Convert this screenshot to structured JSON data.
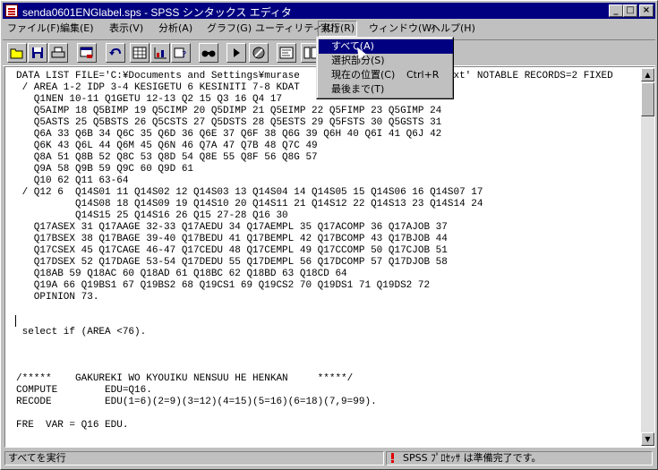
{
  "window": {
    "title": "senda0601ENGlabel.sps - SPSS シンタックス エディタ"
  },
  "menubar": {
    "items": [
      "ファイル(F)",
      "編集(E)",
      "表示(V)",
      "分析(A)",
      "グラフ(G)",
      "ユーティリティ(U)",
      "実行(R)",
      "ウィンドウ(W)",
      "ヘルプ(H)"
    ],
    "active_index": 6
  },
  "toolbar": {
    "buttons": [
      "open-icon",
      "save-icon",
      "print-icon",
      "dialog-recall-icon",
      "undo-icon",
      "goto-data-icon",
      "goto-chart-icon",
      "variables-icon",
      "find-icon",
      "run-icon",
      "stop-icon",
      "syntax-help-icon",
      "use-sets-icon"
    ]
  },
  "run_menu": {
    "items": [
      {
        "label": "すべて(A)",
        "shortcut": "",
        "selected": true
      },
      {
        "label": "選択部分(S)",
        "shortcut": "",
        "selected": false
      },
      {
        "label": "現在の位置(C)",
        "shortcut": "Ctrl+R",
        "selected": false
      },
      {
        "label": "最後まで(T)",
        "shortcut": "",
        "selected": false
      }
    ]
  },
  "editor": {
    "lines": [
      "DATA LIST FILE='C:¥Documents and Settings¥murase                        .txt' NOTABLE RECORDS=2 FIXED",
      " / AREA 1-2 IDP 3-4 KESIGETU 6 KESINITI 7-8 KDAT",
      "   Q1NEN 10-11 Q1GETU 12-13 Q2 15 Q3 16 Q4 17",
      "   Q5AIMP 18 Q5BIMP 19 Q5CIMP 20 Q5DIMP 21 Q5EIMP 22 Q5FIMP 23 Q5GIMP 24",
      "   Q5ASTS 25 Q5BSTS 26 Q5CSTS 27 Q5DSTS 28 Q5ESTS 29 Q5FSTS 30 Q5GSTS 31",
      "   Q6A 33 Q6B 34 Q6C 35 Q6D 36 Q6E 37 Q6F 38 Q6G 39 Q6H 40 Q6I 41 Q6J 42",
      "   Q6K 43 Q6L 44 Q6M 45 Q6N 46 Q7A 47 Q7B 48 Q7C 49",
      "   Q8A 51 Q8B 52 Q8C 53 Q8D 54 Q8E 55 Q8F 56 Q8G 57",
      "   Q9A 58 Q9B 59 Q9C 60 Q9D 61",
      "   Q10 62 Q11 63-64",
      " / Q12 6  Q14S01 11 Q14S02 12 Q14S03 13 Q14S04 14 Q14S05 15 Q14S06 16 Q14S07 17",
      "          Q14S08 18 Q14S09 19 Q14S10 20 Q14S11 21 Q14S12 22 Q14S13 23 Q14S14 24",
      "          Q14S15 25 Q14S16 26 Q15 27-28 Q16 30",
      "   Q17ASEX 31 Q17AAGE 32-33 Q17AEDU 34 Q17AEMPL 35 Q17ACOMP 36 Q17AJOB 37",
      "   Q17BSEX 38 Q17BAGE 39-40 Q17BEDU 41 Q17BEMPL 42 Q17BCOMP 43 Q17BJOB 44",
      "   Q17CSEX 45 Q17CAGE 46-47 Q17CEDU 48 Q17CEMPL 49 Q17CCOMP 50 Q17CJOB 51",
      "   Q17DSEX 52 Q17DAGE 53-54 Q17DEDU 55 Q17DEMPL 56 Q17DCOMP 57 Q17DJOB 58",
      "   Q18AB 59 Q18AC 60 Q18AD 61 Q18BC 62 Q18BD 63 Q18CD 64",
      "   Q19A 66 Q19BS1 67 Q19BS2 68 Q19CS1 69 Q19CS2 70 Q19DS1 71 Q19DS2 72",
      "   OPINION 73.",
      "",
      "",
      " select if (AREA <76).",
      "",
      "",
      "",
      "/*****    GAKUREKI WO KYOUIKU NENSUU HE HENKAN     *****/",
      "COMPUTE        EDU=Q16.",
      "RECODE         EDU(1=6)(2=9)(3=12)(4=15)(5=16)(6=18)(7,9=99).",
      "",
      "FRE  VAR = Q16 EDU."
    ]
  },
  "status": {
    "left": "すべてを実行",
    "right": "SPSS ﾌﾟﾛｾｯｻ  は準備完了です。"
  }
}
